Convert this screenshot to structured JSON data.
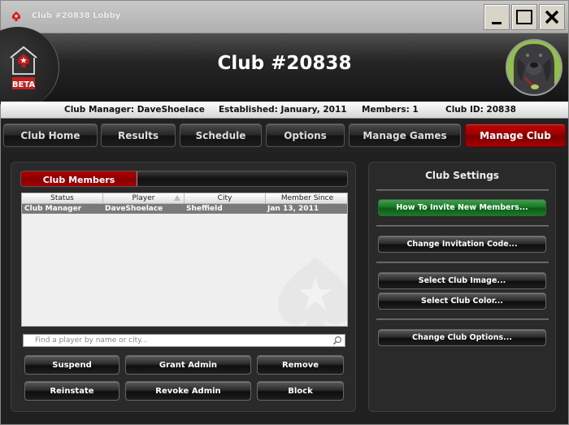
{
  "window": {
    "title": "Club #20838 Lobby",
    "controls": {
      "minimize": "minimize",
      "maximize": "maximize",
      "close": "✕"
    }
  },
  "header": {
    "title": "Club #20838",
    "badge": "BETA"
  },
  "info": {
    "manager": "Club Manager: DaveShoelace",
    "established": "Established: January, 2011",
    "members": "Members: 1",
    "club_id": "Club ID: 20838"
  },
  "nav": {
    "tabs": [
      {
        "label": "Club Home"
      },
      {
        "label": "Results"
      },
      {
        "label": "Schedule"
      },
      {
        "label": "Options"
      },
      {
        "label": "Manage Games"
      },
      {
        "label": "Manage Club",
        "active": true
      }
    ]
  },
  "members": {
    "tab_label": "Club Members",
    "columns": [
      "Status",
      "Player",
      "City",
      "Member Since"
    ],
    "sorted_column": "Player",
    "rows": [
      {
        "status": "Club Manager",
        "player": "DaveShoelace",
        "city": "Sheffield",
        "since": "Jan 13, 2011"
      }
    ],
    "search_placeholder": "Find a player by name or city...",
    "actions": {
      "suspend": "Suspend",
      "grant_admin": "Grant Admin",
      "remove": "Remove",
      "reinstate": "Reinstate",
      "revoke_admin": "Revoke Admin",
      "block": "Block"
    }
  },
  "settings": {
    "title": "Club Settings",
    "buttons": {
      "invite": "How To Invite New Members...",
      "invitation_code": "Change Invitation Code...",
      "club_image": "Select Club Image...",
      "club_color": "Select Club Color...",
      "club_options": "Change Club Options..."
    }
  },
  "colors": {
    "accent_red": "#a00000",
    "accent_green": "#187a26"
  }
}
